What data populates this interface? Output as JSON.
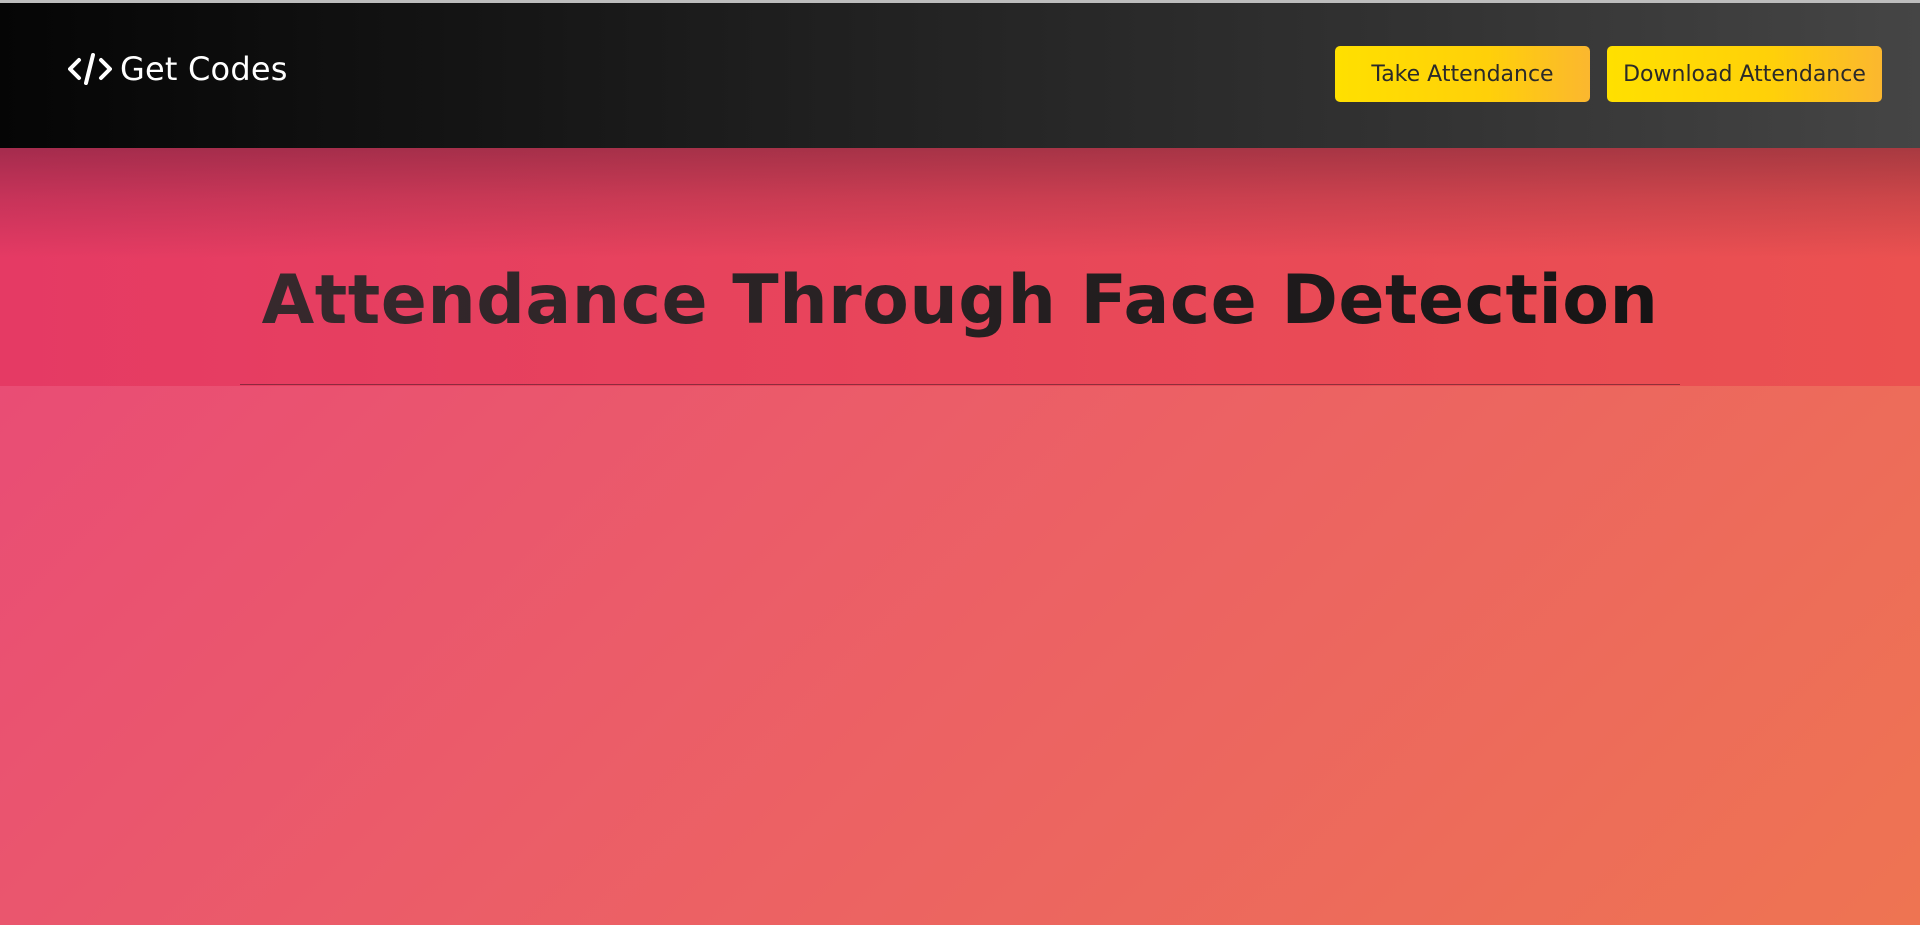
{
  "navbar": {
    "brand_text": "Get Codes",
    "brand_icon": "code-icon",
    "buttons": {
      "take_attendance": "Take Attendance",
      "download_attendance": "Download Attendance"
    }
  },
  "hero": {
    "title": "Attendance Through Face Detection"
  },
  "colors": {
    "navbar_start": "#050505",
    "navbar_end": "#454545",
    "button_yellow": "#ffd700",
    "button_orange": "#fbb72f",
    "hero_pink": "#e53a64",
    "hero_red": "#eb5150",
    "page_pink": "#e8467a",
    "page_orange": "#ee7452"
  }
}
